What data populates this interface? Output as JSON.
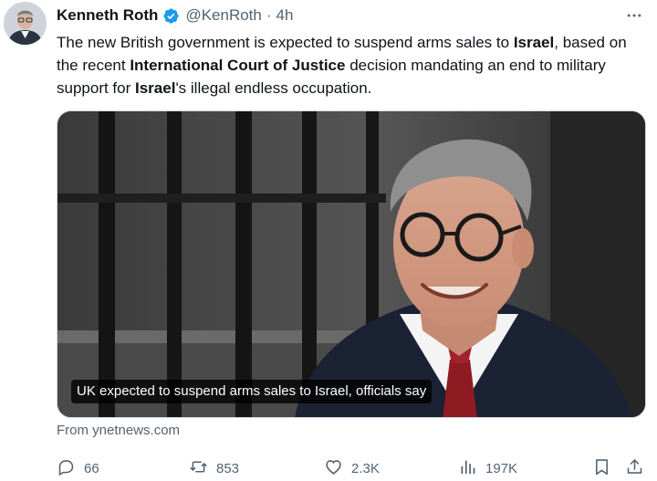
{
  "author": {
    "name": "Kenneth Roth",
    "handle": "@KenRoth",
    "separator": "·",
    "time": "4h"
  },
  "tweet": {
    "text_parts": [
      {
        "text": "The new British government is expected to suspend arms sales to ",
        "bold": false
      },
      {
        "text": "Israel",
        "bold": true
      },
      {
        "text": ", based on the recent ",
        "bold": false
      },
      {
        "text": "International Court of Justice",
        "bold": true
      },
      {
        "text": " decision mandating an end to military support for ",
        "bold": false
      },
      {
        "text": "Israel",
        "bold": true
      },
      {
        "text": "'s illegal endless occupation.",
        "bold": false
      }
    ]
  },
  "card": {
    "caption": "UK expected to suspend arms sales to Israel, officials say",
    "source": "From ynetnews.com"
  },
  "actions": {
    "replies": "66",
    "reposts": "853",
    "likes": "2.3K",
    "views": "197K"
  },
  "colors": {
    "text_primary": "#0f1419",
    "text_secondary": "#536471",
    "verified_blue": "#1d9bf0"
  }
}
